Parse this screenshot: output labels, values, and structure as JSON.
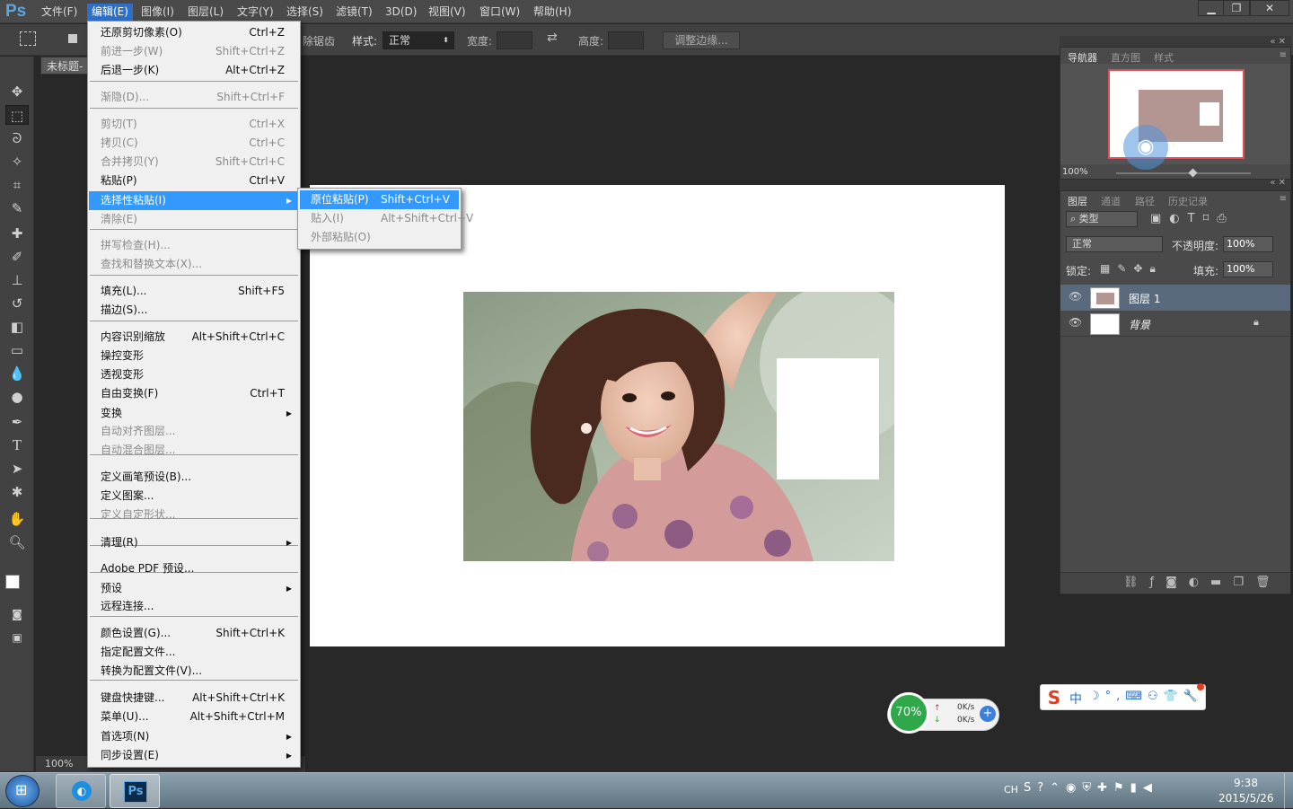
{
  "app": {
    "logo": "Ps"
  },
  "menubar": {
    "items": [
      "文件(F)",
      "编辑(E)",
      "图像(I)",
      "图层(L)",
      "文字(Y)",
      "选择(S)",
      "滤镜(T)",
      "3D(D)",
      "视图(V)",
      "窗口(W)",
      "帮助(H)"
    ],
    "active_index": 1
  },
  "window_controls": {
    "minimize": "▁",
    "restore": "❐",
    "close": "✕"
  },
  "options_bar": {
    "feather_tail": "除锯齿",
    "style_label": "样式:",
    "style_value": "正常",
    "width_label": "宽度:",
    "height_label": "高度:",
    "refine_button": "调整边缘..."
  },
  "document": {
    "tab_title": "未标题-",
    "zoom": "100%"
  },
  "edit_menu": {
    "items": [
      {
        "label": "还原剪切像素(O)",
        "shortcut": "Ctrl+Z",
        "disabled": false
      },
      {
        "label": "前进一步(W)",
        "shortcut": "Shift+Ctrl+Z",
        "disabled": true
      },
      {
        "label": "后退一步(K)",
        "shortcut": "Alt+Ctrl+Z",
        "disabled": false
      },
      {
        "label": "渐隐(D)...",
        "shortcut": "Shift+Ctrl+F",
        "disabled": true
      },
      {
        "label": "剪切(T)",
        "shortcut": "Ctrl+X",
        "disabled": true
      },
      {
        "label": "拷贝(C)",
        "shortcut": "Ctrl+C",
        "disabled": true
      },
      {
        "label": "合并拷贝(Y)",
        "shortcut": "Shift+Ctrl+C",
        "disabled": true
      },
      {
        "label": "粘贴(P)",
        "shortcut": "Ctrl+V",
        "disabled": false
      },
      {
        "label": "选择性粘贴(I)",
        "shortcut": "",
        "disabled": false,
        "submenu": true
      },
      {
        "label": "清除(E)",
        "shortcut": "",
        "disabled": true
      },
      {
        "label": "拼写检查(H)...",
        "shortcut": "",
        "disabled": true
      },
      {
        "label": "查找和替换文本(X)...",
        "shortcut": "",
        "disabled": true
      },
      {
        "label": "填充(L)...",
        "shortcut": "Shift+F5",
        "disabled": false
      },
      {
        "label": "描边(S)...",
        "shortcut": "",
        "disabled": false
      },
      {
        "label": "内容识别缩放",
        "shortcut": "Alt+Shift+Ctrl+C",
        "disabled": false
      },
      {
        "label": "操控变形",
        "shortcut": "",
        "disabled": false
      },
      {
        "label": "透视变形",
        "shortcut": "",
        "disabled": false
      },
      {
        "label": "自由变换(F)",
        "shortcut": "Ctrl+T",
        "disabled": false
      },
      {
        "label": "变换",
        "shortcut": "",
        "disabled": false,
        "submenu": true
      },
      {
        "label": "自动对齐图层...",
        "shortcut": "",
        "disabled": true
      },
      {
        "label": "自动混合图层...",
        "shortcut": "",
        "disabled": true
      },
      {
        "label": "定义画笔预设(B)...",
        "shortcut": "",
        "disabled": false
      },
      {
        "label": "定义图案...",
        "shortcut": "",
        "disabled": false
      },
      {
        "label": "定义自定形状...",
        "shortcut": "",
        "disabled": true
      },
      {
        "label": "清理(R)",
        "shortcut": "",
        "disabled": false,
        "submenu": true
      },
      {
        "label": "Adobe PDF 预设...",
        "shortcut": "",
        "disabled": false
      },
      {
        "label": "预设",
        "shortcut": "",
        "disabled": false,
        "submenu": true
      },
      {
        "label": "远程连接...",
        "shortcut": "",
        "disabled": false
      },
      {
        "label": "颜色设置(G)...",
        "shortcut": "Shift+Ctrl+K",
        "disabled": false
      },
      {
        "label": "指定配置文件...",
        "shortcut": "",
        "disabled": false
      },
      {
        "label": "转换为配置文件(V)...",
        "shortcut": "",
        "disabled": false
      },
      {
        "label": "键盘快捷键...",
        "shortcut": "Alt+Shift+Ctrl+K",
        "disabled": false
      },
      {
        "label": "菜单(U)...",
        "shortcut": "Alt+Shift+Ctrl+M",
        "disabled": false
      },
      {
        "label": "首选项(N)",
        "shortcut": "",
        "disabled": false,
        "submenu": true
      },
      {
        "label": "同步设置(E)",
        "shortcut": "",
        "disabled": false,
        "submenu": true
      }
    ],
    "highlighted_index": 8
  },
  "paste_special_submenu": {
    "items": [
      {
        "label": "原位粘贴(P)",
        "shortcut": "Shift+Ctrl+V",
        "disabled": false
      },
      {
        "label": "贴入(I)",
        "shortcut": "Alt+Shift+Ctrl+V",
        "disabled": true
      },
      {
        "label": "外部粘贴(O)",
        "shortcut": "",
        "disabled": true
      }
    ],
    "highlighted_index": 0
  },
  "navigator_panel": {
    "tabs": [
      "导航器",
      "直方图",
      "样式"
    ],
    "zoom": "100%"
  },
  "layers_panel": {
    "tabs": [
      "图层",
      "通道",
      "路径",
      "历史记录"
    ],
    "filter_kind": "类型",
    "blend_mode": "正常",
    "opacity_label": "不透明度:",
    "opacity_value": "100%",
    "lock_label": "锁定:",
    "fill_label": "填充:",
    "fill_value": "100%",
    "layers": [
      {
        "name": "图层 1",
        "selected": true,
        "locked": false
      },
      {
        "name": "背景",
        "selected": false,
        "locked": true
      }
    ]
  },
  "net_monitor": {
    "percent": "70%",
    "up": "0K/s",
    "down": "0K/s"
  },
  "ime": {
    "mode": "中"
  },
  "taskbar": {
    "lang": "CH",
    "time": "9:38",
    "date": "2015/5/26",
    "ps_label": "Ps"
  },
  "colors": {
    "accent": "#3399ff",
    "menu_active": "#2e70c7",
    "ps_blue": "#5aa7e8",
    "net_green": "#2ea84a"
  }
}
